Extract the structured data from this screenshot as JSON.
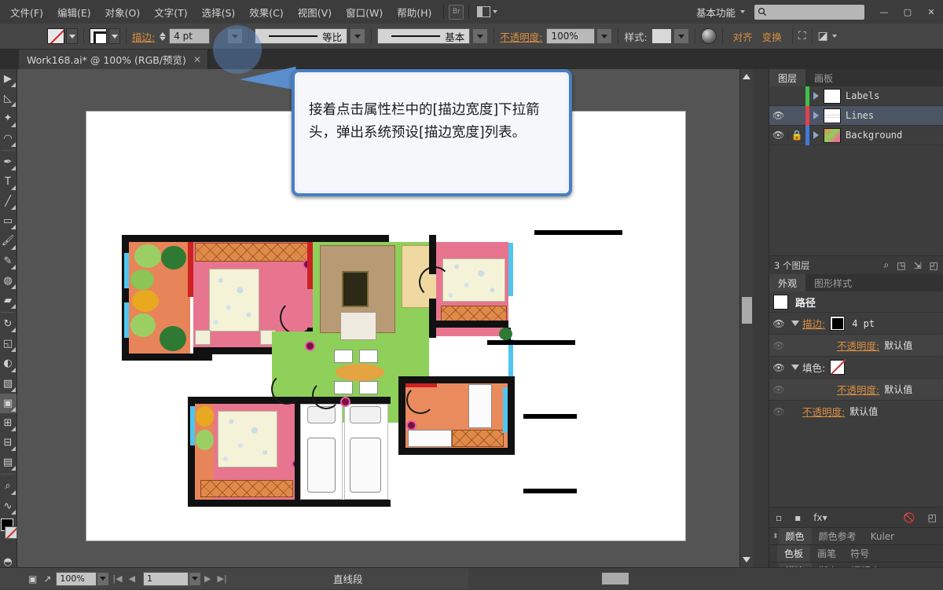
{
  "app": {
    "menus": [
      "文件(F)",
      "编辑(E)",
      "对象(O)",
      "文字(T)",
      "选择(S)",
      "效果(C)",
      "视图(V)",
      "窗口(W)",
      "帮助(H)"
    ],
    "bridge_label": "Br",
    "arrange_icon": "arrange-documents-icon",
    "workspace": "基本功能",
    "search_placeholder": "",
    "window_buttons": {
      "minimize": "—",
      "maximize": "▢",
      "close": "✕"
    }
  },
  "control_bar": {
    "fill_swatch": "none-swatch",
    "stroke_swatch": "black-stroke-swatch",
    "stroke_label": "描边:",
    "stroke_weight": "4 pt",
    "profile_variable": "等比",
    "brush_definition": "基本",
    "opacity_label": "不透明度:",
    "opacity_value": "100%",
    "style_label": "样式:",
    "align_button": "对齐",
    "transform_button": "变换",
    "isolate_icon": "isolate-selected-icon",
    "recolor_icon": "recolor-artwork-icon",
    "draw_mode_icon": "draw-mode-icon"
  },
  "document": {
    "tab_title": "Work168.ai* @ 100% (RGB/预览)",
    "close_glyph": "✕"
  },
  "callout": {
    "text": "接着点击属性栏中的[描边宽度]下拉箭头，弹出系统预设[描边宽度]列表。",
    "border_color": "#4a7fc1",
    "fill_color": "#f5f7fa",
    "highlight_color": "#5a8ecd"
  },
  "panels": {
    "layers": {
      "tabs": [
        {
          "label": "图层",
          "active": true
        },
        {
          "label": "画板",
          "active": false
        }
      ],
      "rows": [
        {
          "name": "Labels",
          "visible": false,
          "locked": false,
          "color": "#3fc14a",
          "selected": false,
          "thumb": "blank-thumb"
        },
        {
          "name": "Lines",
          "visible": true,
          "locked": false,
          "color": "#e0414f",
          "selected": true,
          "thumb": "lines-thumb"
        },
        {
          "name": "Background",
          "visible": true,
          "locked": true,
          "color": "#3f7ad6",
          "selected": false,
          "thumb": "plan-thumb"
        }
      ],
      "count_label": "3 个图层",
      "footer_icons": [
        "locate-object-icon",
        "make-clipping-mask-icon",
        "create-new-sublayer-icon",
        "create-new-layer-icon",
        "delete-selection-icon"
      ]
    },
    "appearance": {
      "tabs": [
        {
          "label": "外观",
          "active": true
        },
        {
          "label": "图形样式",
          "active": false
        }
      ],
      "object_type": "路径",
      "rows": [
        {
          "indent": 0,
          "eye": "on",
          "arrow": "down",
          "label": "描边:",
          "orange": true,
          "chip": "black",
          "value": "4 pt"
        },
        {
          "indent": 1,
          "eye": "off",
          "arrow": "none",
          "label": "不透明度:",
          "orange": true,
          "chip": "none-hidden",
          "value": "默认值"
        },
        {
          "indent": 0,
          "eye": "on",
          "arrow": "down",
          "label": "填色:",
          "orange": false,
          "chip": "none",
          "value": ""
        },
        {
          "indent": 1,
          "eye": "off",
          "arrow": "none",
          "label": "不透明度:",
          "orange": true,
          "chip": "none-hidden",
          "value": "默认值"
        },
        {
          "indent": 0,
          "eye": "off",
          "arrow": "none",
          "label": "不透明度:",
          "orange": true,
          "chip": "none-hidden",
          "value": "默认值"
        }
      ],
      "footer_icons": [
        "add-new-stroke-icon",
        "add-new-fill-icon",
        "add-effect-fx-icon",
        "clear-appearance-icon",
        "duplicate-item-icon"
      ]
    },
    "color_group": {
      "tabs": [
        "颜色",
        "颜色参考",
        "Kuler"
      ]
    },
    "swatch_group": {
      "tabs": [
        "色板",
        "画笔",
        "符号"
      ]
    },
    "stroke_group": {
      "tabs": [
        "描边",
        "渐变",
        "透明度"
      ]
    }
  },
  "toolbar": {
    "tools": [
      "selection-tool",
      "direct-selection-tool",
      "magic-wand-tool",
      "lasso-tool",
      "pen-tool",
      "type-tool",
      "line-segment-tool",
      "rectangle-tool",
      "paintbrush-tool",
      "pencil-tool",
      "blob-brush-tool",
      "eraser-tool",
      "rotate-tool",
      "scale-tool",
      "width-tool",
      "free-transform-tool",
      "shape-builder-tool",
      "perspective-grid-tool",
      "mesh-tool",
      "gradient-tool",
      "eyedropper-tool",
      "blend-tool",
      "symbol-sprayer-tool",
      "column-graph-tool",
      "artboard-tool",
      "slice-tool",
      "hand-tool",
      "zoom-tool"
    ],
    "fill_color": "#000000",
    "stroke_color": "none"
  },
  "status_bar": {
    "zoom": "100%",
    "artboard_number": "1",
    "active_tool": "直线段",
    "nav_first": "|◀",
    "nav_prev": "◀",
    "nav_next": "▶",
    "nav_last": "▶|"
  },
  "artwork": {
    "leader_lines": 4,
    "description": "floor-plan-illustration"
  }
}
